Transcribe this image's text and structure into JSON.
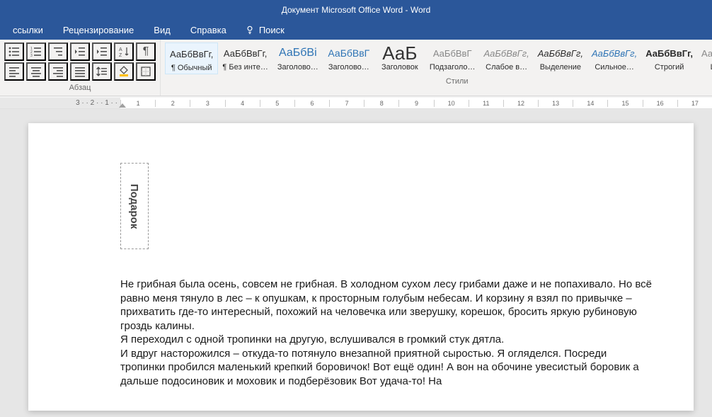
{
  "title_bar": {
    "text": "Документ Microsoft Office Word  -  Word"
  },
  "menu": {
    "items": [
      "ссылки",
      "Рецензирование",
      "Вид",
      "Справка"
    ],
    "search_label": "Поиск"
  },
  "paragraph_panel": {
    "label": "Абзац"
  },
  "styles_panel": {
    "label": "Стили",
    "items": [
      {
        "preview": "АаБбВвГг,",
        "name": "¶ Обычный",
        "cls": "reg",
        "sel": true
      },
      {
        "preview": "АаБбВвГг,",
        "name": "¶ Без инте…",
        "cls": "reg"
      },
      {
        "preview": "АаБбВі",
        "name": "Заголово…",
        "cls": "h1"
      },
      {
        "preview": "АаБбВвГ",
        "name": "Заголово…",
        "cls": "h2"
      },
      {
        "preview": "АаБбВвГг",
        "name": "Заголовок",
        "cls": "h3"
      },
      {
        "preview": "АаБбВвГ",
        "name": "Подзаголо…",
        "cls": "sub"
      },
      {
        "preview": "АаБбВвГг,",
        "name": "Слабое в…",
        "cls": "weak"
      },
      {
        "preview": "АаБбВвГг,",
        "name": "Выделение",
        "cls": "emph"
      },
      {
        "preview": "АаБбВвГг,",
        "name": "Сильное…",
        "cls": "strong"
      },
      {
        "preview": "АаБбВвГг,",
        "name": "Строгий",
        "cls": "strict"
      },
      {
        "preview": "АаБбВвГг,",
        "name": "Цитата",
        "cls": "quote"
      }
    ],
    "big_preview": "АаБ"
  },
  "ruler": {
    "left_ticks": [
      "3",
      "2",
      "1"
    ],
    "ticks": [
      "1",
      "2",
      "3",
      "4",
      "5",
      "6",
      "7",
      "8",
      "9",
      "10",
      "11",
      "12",
      "13",
      "14",
      "15",
      "16",
      "17"
    ]
  },
  "document": {
    "title_box": "Подарок",
    "paragraphs": [
      "Не грибная была осень, совсем не грибная. В холодном сухом лесу грибами даже и не попахивало. Но всё равно меня тянуло в лес – к опушкам, к просторным голубым небесам. И корзину я взял по привычке – прихватить где-то интересный, похожий на человечка или зверушку, корешок, бросить яркую рубиновую гроздь калины.",
      "Я переходил с одной тропинки на другую, вслушивался в громкий стук дятла.",
      "И вдруг насторожился – откуда-то потянуло внезапной приятной сыростью. Я огляделся. Посреди тропинки пробился маленький крепкий боровичок! Вот ещё один! А вон на обочине увесистый боровик  а дальше подосиновик и моховик  и подберёзовик  Вот удача-то! На"
    ]
  }
}
